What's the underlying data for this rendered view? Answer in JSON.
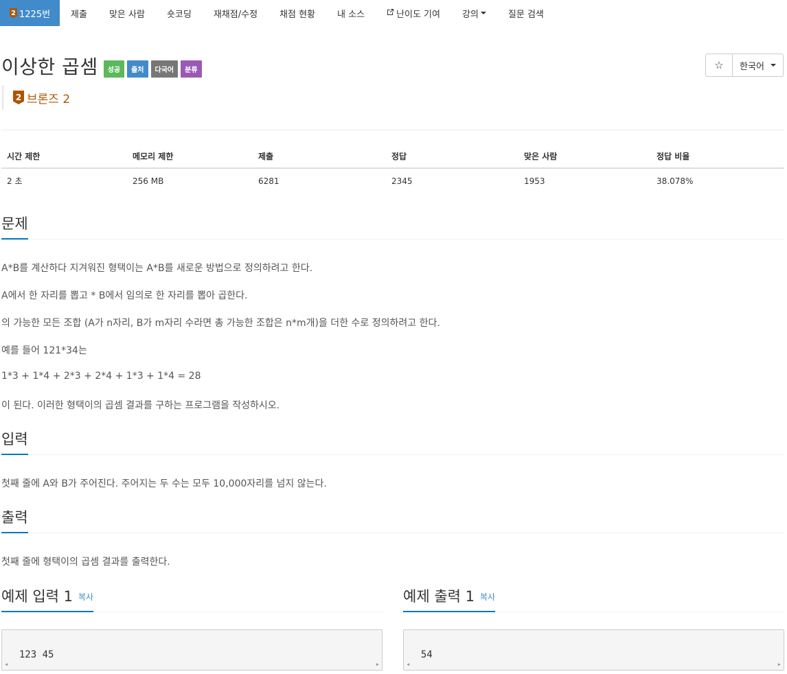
{
  "nav": {
    "problem_number": "1225번",
    "tier_digit": "2",
    "items": [
      "제출",
      "맞은 사람",
      "숏코딩",
      "재채점/수정",
      "채점 현황",
      "내 소스"
    ],
    "contribute": "난이도 기여",
    "lecture": "강의",
    "question_search": "질문 검색"
  },
  "problem": {
    "title": "이상한 곱셈",
    "labels": [
      "성공",
      "출처",
      "다국어",
      "분류"
    ],
    "tier_digit": "2",
    "tier": "브론즈 2",
    "star_icon": "☆",
    "language": "한국어"
  },
  "info": {
    "headers": [
      "시간 제한",
      "메모리 제한",
      "제출",
      "정답",
      "맞은 사람",
      "정답 비율"
    ],
    "values": [
      "2 초",
      "256 MB",
      "6281",
      "2345",
      "1953",
      "38.078%"
    ]
  },
  "sections": {
    "description": {
      "title": "문제",
      "paragraphs": [
        "A*B를 계산하다 지겨워진 형택이는 A*B를 새로운 방법으로 정의하려고 한다.",
        "A에서 한 자리를 뽑고 * B에서 임의로 한 자리를 뽑아 곱한다.",
        "의 가능한 모든 조합 (A가 n자리, B가 m자리 수라면 총 가능한 조합은 n*m개)을 더한 수로 정의하려고 한다.",
        "예를 들어 121*34는",
        "1*3 + 1*4 + 2*3 + 2*4 + 1*3 + 1*4 = 28",
        "이 된다. 이러한 형택이의 곱셈 결과를 구하는 프로그램을 작성하시오."
      ]
    },
    "input": {
      "title": "입력",
      "text": "첫째 줄에 A와 B가 주어진다. 주어지는 두 수는 모두 10,000자리를 넘지 않는다."
    },
    "output": {
      "title": "출력",
      "text": "첫째 줄에 형택이의 곱셈 결과를 출력한다."
    },
    "sample_input": {
      "title": "예제 입력 1",
      "copy": "복사",
      "content": "123 45"
    },
    "sample_output": {
      "title": "예제 출력 1",
      "copy": "복사",
      "content": "54"
    }
  },
  "colors": {
    "primary": "#428bca",
    "tier_bronze": "#ad5600",
    "success": "#5cb85c",
    "multilang": "#777777",
    "classification": "#9b59b6",
    "heading_underline": "#0076c0"
  }
}
